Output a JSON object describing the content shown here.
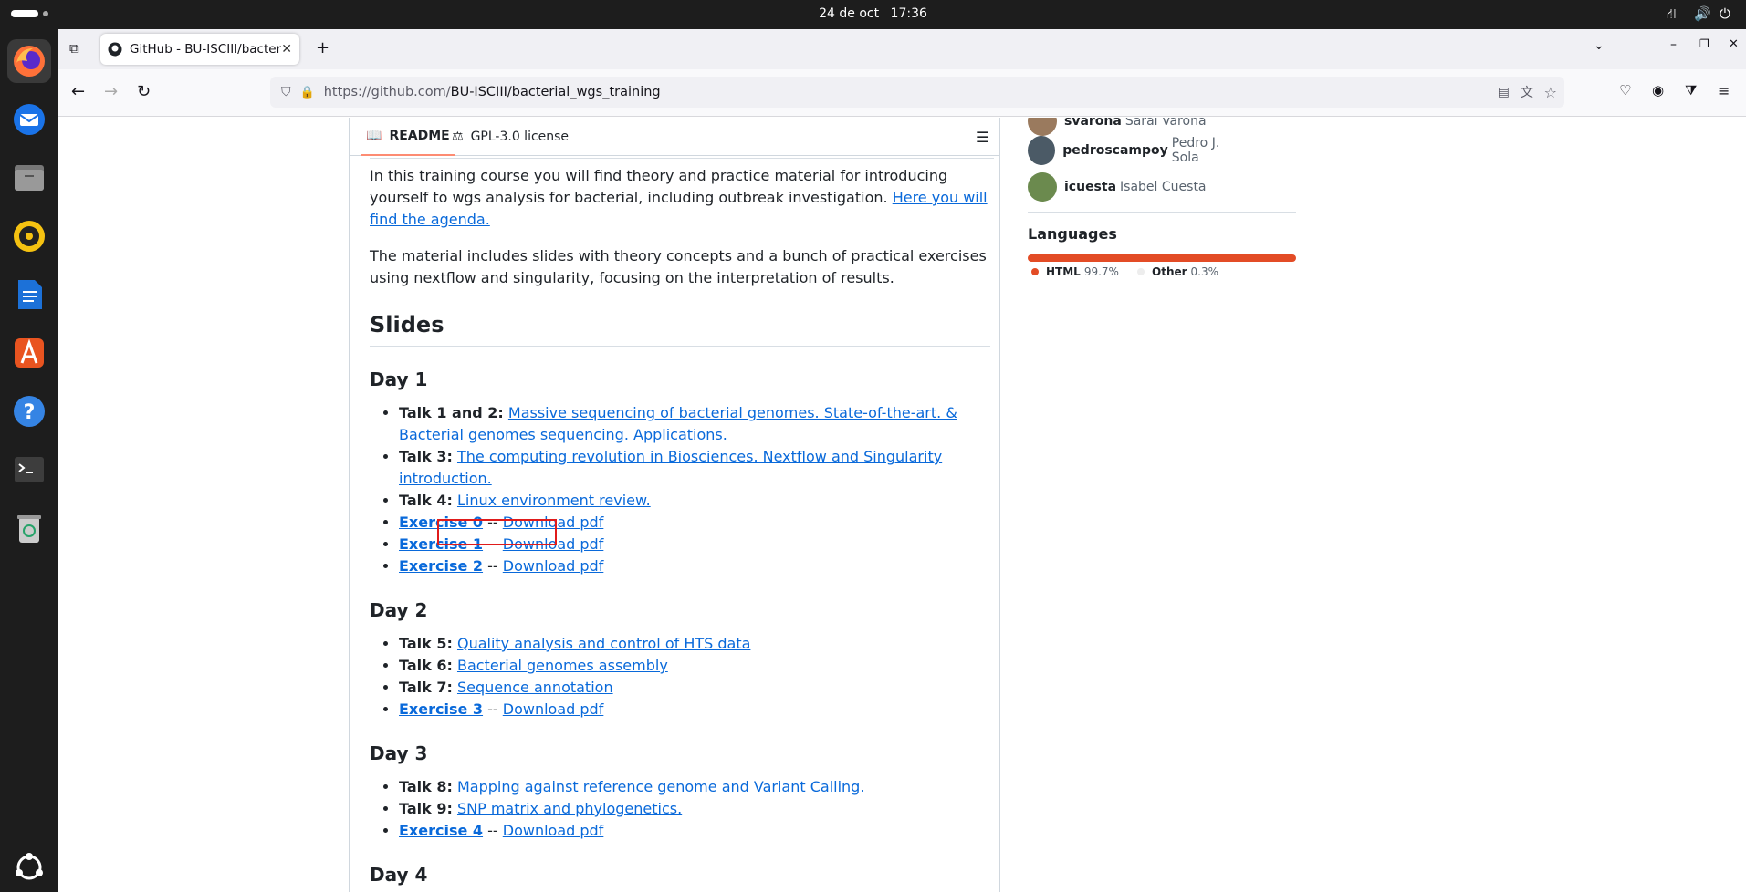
{
  "system": {
    "date": "24 de oct",
    "time": "17:36"
  },
  "browser": {
    "tab_title": "GitHub - BU-ISCIII/bacterial_wgs_training",
    "url_prefix": "https://github.com/",
    "url_path": "BU-ISCIII/bacterial_wgs_training"
  },
  "readme_tabs": {
    "readme": "README",
    "license": "GPL-3.0 license"
  },
  "content": {
    "intro_1": "In this training course you will find theory and practice material for introducing yourself to wgs analysis for bacterial, including outbreak investigation.",
    "intro_link": "Here you will find the agenda.",
    "intro_2": "The material includes slides with theory concepts and a bunch of practical exercises using nextflow and singularity, focusing on the interpretation of results.",
    "slides_heading": "Slides",
    "days": [
      {
        "title": "Day 1"
      },
      {
        "title": "Day 2"
      },
      {
        "title": "Day 3"
      },
      {
        "title": "Day 4"
      }
    ],
    "items": {
      "t12_label": "Talk 1 and 2:",
      "t12_link": "Massive sequencing of bacterial genomes. State-of-the-art. & Bacterial genomes sequencing. Applications.",
      "t3_label": "Talk 3:",
      "t3_link": "The computing revolution in Biosciences. Nextflow and Singularity introduction.",
      "t4_label": "Talk 4:",
      "t4_link": "Linux environment review.",
      "e0": "Exercise 0",
      "e1": "Exercise 1",
      "e2": "Exercise 2",
      "sep": " -- ",
      "download": "Download pdf",
      "t5_label": "Talk 5:",
      "t5_link": "Quality analysis and control of HTS data",
      "t6_label": "Talk 6:",
      "t6_link": "Bacterial genomes assembly",
      "t7_label": "Talk 7:",
      "t7_link": "Sequence annotation",
      "e3": "Exercise 3",
      "t8_label": "Talk 8:",
      "t8_link": "Mapping against reference genome and Variant Calling.",
      "t9_label": "Talk 9:",
      "t9_link": "SNP matrix and phylogenetics.",
      "e4": "Exercise 4"
    }
  },
  "sidebar": {
    "contributors": [
      {
        "user": "svarona",
        "name": "Sarai Varona"
      },
      {
        "user": "pedroscampoy",
        "name": "Pedro J. Sola"
      },
      {
        "user": "icuesta",
        "name": "Isabel Cuesta"
      }
    ],
    "languages_title": "Languages",
    "languages": [
      {
        "name": "HTML",
        "pct": "99.7%",
        "color": "#e34c26"
      },
      {
        "name": "Other",
        "pct": "0.3%",
        "color": "#ededed"
      }
    ]
  }
}
